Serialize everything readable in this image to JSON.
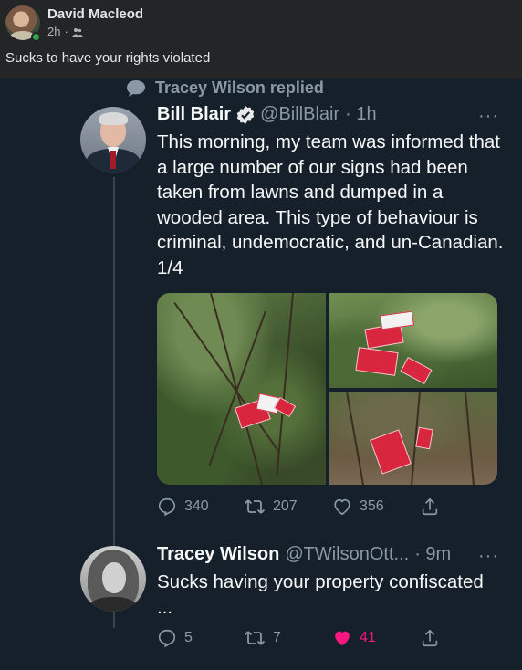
{
  "fb_post": {
    "author": "David Macleod",
    "time": "2h",
    "separator": "·",
    "audience_icon": "friends-icon",
    "text": "Sucks to have your rights violated"
  },
  "tweet_context": {
    "replied_label": "Tracey Wilson replied"
  },
  "tweet_main": {
    "name": "Bill Blair",
    "handle": "@BillBlair",
    "time": "· 1h",
    "more": "···",
    "body": "This morning, my team was informed that a large number of our signs had been taken from lawns and dumped in a wooded area. This type of behaviour is criminal, undemocratic, and un-Canadian. 1/4",
    "replies": "340",
    "retweets": "207",
    "likes": "356"
  },
  "tweet_reply": {
    "name": "Tracey Wilson",
    "handle": "@TWilsonOtt...",
    "time": "· 9m",
    "more": "···",
    "body": "Sucks having your property confiscated ...",
    "replies": "5",
    "retweets": "7",
    "likes": "41"
  },
  "colors": {
    "fb_bg": "#242526",
    "twitter_bg": "#15202b",
    "muted": "#8b98a5",
    "like_active": "#f91880",
    "verified": "#e7e9ea"
  }
}
